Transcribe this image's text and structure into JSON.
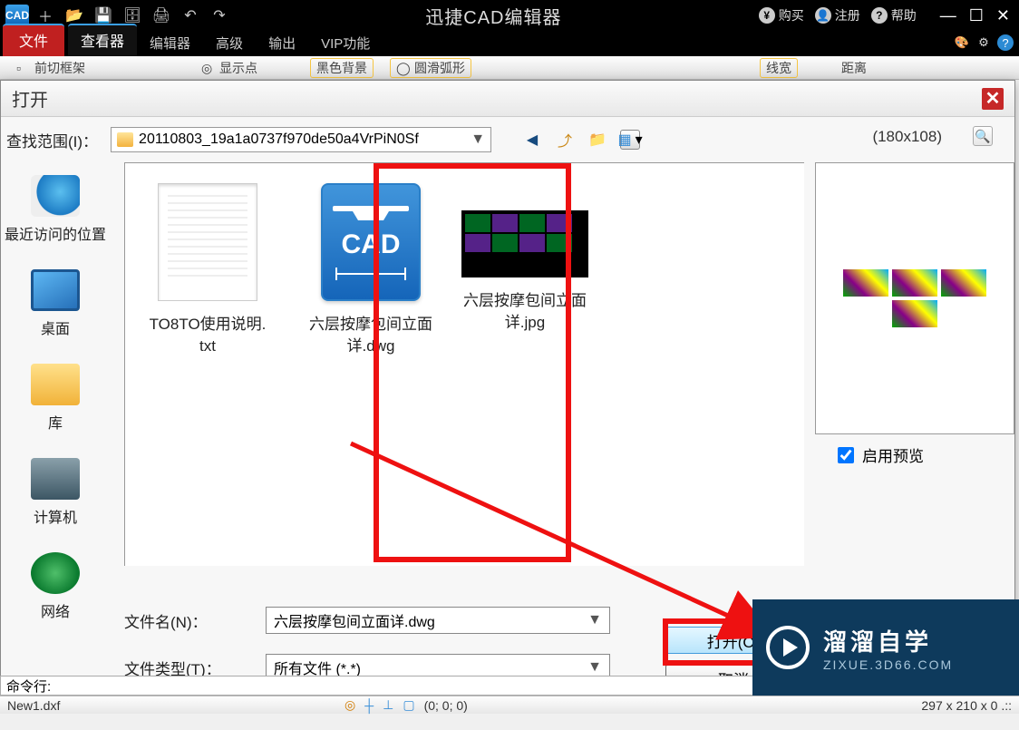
{
  "titlebar": {
    "app_short": "CAD",
    "title": "迅捷CAD编辑器",
    "buy": "购买",
    "register": "注册",
    "help": "帮助"
  },
  "ribbon": {
    "file": "文件",
    "viewer": "查看器",
    "editor": "编辑器",
    "advanced": "高级",
    "output": "输出",
    "vip": "VIP功能"
  },
  "tb2": {
    "a": "前切框架",
    "b": "显示点",
    "c": "黑色背景",
    "d": "圆滑弧形",
    "e": "线宽",
    "f": "距离"
  },
  "dialog": {
    "title": "打开",
    "lookin": "查找范围(I)：",
    "folder": "20110803_19a1a0737f970de50a4VrPiN0Sf",
    "preview_dim": "(180x108)",
    "places": {
      "recent": "最近访问的位置",
      "desktop": "桌面",
      "library": "库",
      "computer": "计算机",
      "network": "网络"
    },
    "files": {
      "txt": "TO8TO使用说明.\ntxt",
      "dwg": "六层按摩包间立面\n详.dwg",
      "jpg": "六层按摩包间立面\n详.jpg"
    },
    "filename_label": "文件名(N)：",
    "filetype_label": "文件类型(T)：",
    "filename_value": "六层按摩包间立面详.dwg",
    "filetype_value": "所有文件 (*.*)",
    "open_btn": "打开(O)",
    "cancel_btn": "取消",
    "enable_preview": "启用预览"
  },
  "watermark": {
    "line1": "溜溜自学",
    "line2": "ZIXUE.3D66.COM"
  },
  "status": {
    "cmd": "命令行:",
    "file": "New1.dxf",
    "coords": "(0; 0; 0)",
    "dims": "297 x 210 x 0 .::"
  }
}
